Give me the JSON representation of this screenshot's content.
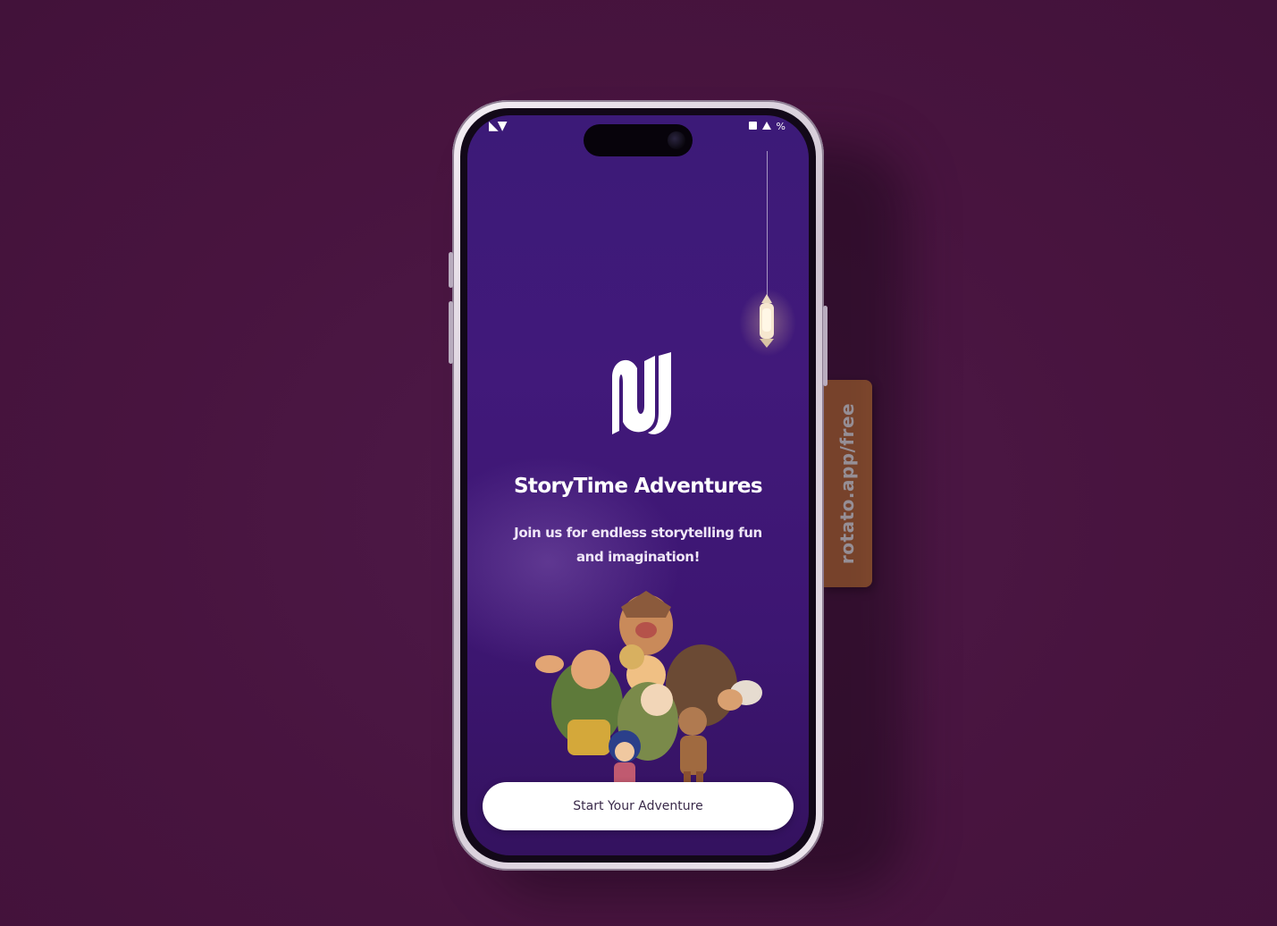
{
  "status_bar": {
    "left": "◣▼",
    "right_icons": [
      "signal-icon",
      "wifi-icon",
      "battery-icon"
    ],
    "battery_text": "%"
  },
  "app": {
    "title": "StoryTime Adventures",
    "subtitle": "Join us for endless storytelling fun and imagination!",
    "start_button_label": "Start Your Adventure",
    "logo_icon": "story-logo-icon",
    "illustration": "characters-group-illustration",
    "decoration": "hanging-lantern-icon"
  },
  "side_tag": {
    "label": "rotato.app/free"
  },
  "colors": {
    "background": "#4a1646",
    "screen": "#3c1a78",
    "button": "#ffffff",
    "tag": "#c8763e"
  }
}
